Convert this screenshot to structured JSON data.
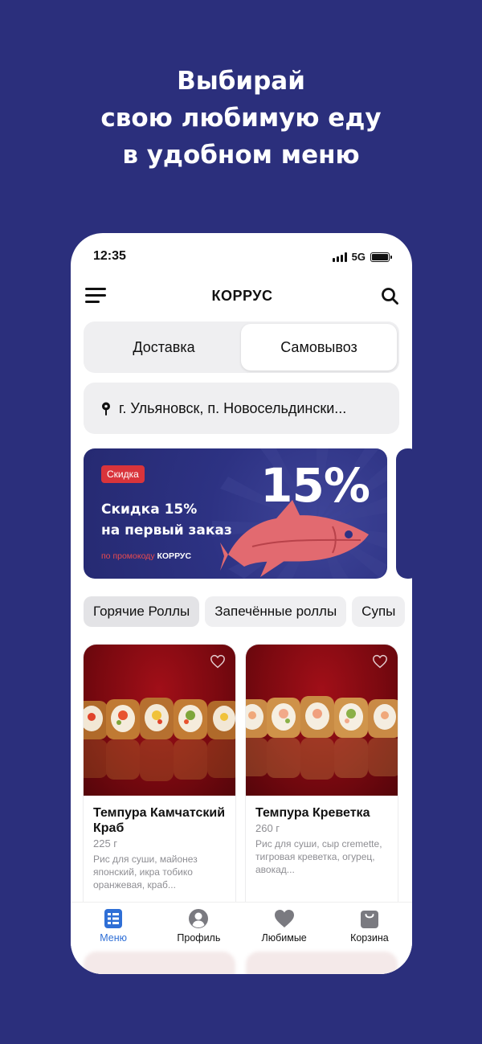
{
  "promo_headline": [
    "Выбирай",
    "свою любимую еду",
    "в удобном меню"
  ],
  "status_bar": {
    "time": "12:35",
    "network": "5G"
  },
  "header": {
    "title": "КОРРУС"
  },
  "delivery_toggle": {
    "delivery": "Доставка",
    "pickup": "Самовывоз",
    "selected": "pickup"
  },
  "address": "г. Ульяновск, п. Новосельдински...",
  "banner": {
    "badge": "Скидка",
    "title_line1": "Скидка 15%",
    "title_line2": "на первый заказ",
    "code_prefix": "по промокоду ",
    "code": "КОРРУС",
    "percent": "15%"
  },
  "categories": [
    "Горячие Роллы",
    "Запечённые роллы",
    "Супы"
  ],
  "products": [
    {
      "name": "Темпура Камчатский Краб",
      "weight": "225 г",
      "description": "Рис для суши, майонез японский, икра тобико оранжевая, краб..."
    },
    {
      "name": "Темпура Креветка",
      "weight": "260 г",
      "description": "Рис для суши, сыр cremette, тигровая креветка, огурец, авокад..."
    }
  ],
  "tabbar": [
    {
      "label": "Меню",
      "icon": "menu-list-icon",
      "active": true
    },
    {
      "label": "Профиль",
      "icon": "profile-icon",
      "active": false
    },
    {
      "label": "Любимые",
      "icon": "heart-icon",
      "active": false
    },
    {
      "label": "Корзина",
      "icon": "bag-icon",
      "active": false
    }
  ],
  "colors": {
    "background": "#2b2f7c",
    "accent": "#2f6fd6",
    "badge": "#d9343b"
  }
}
